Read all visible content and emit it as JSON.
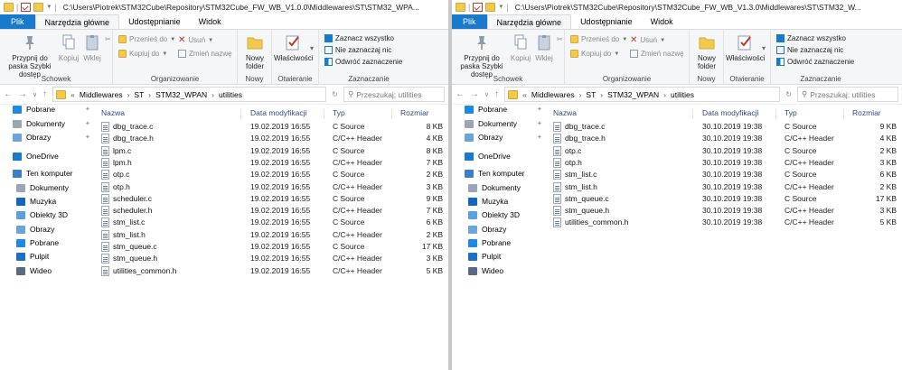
{
  "windows": [
    {
      "title_path": "C:\\Users\\Piotrek\\STM32Cube\\Repository\\STM32Cube_FW_WB_V1.0.0\\Middlewares\\ST\\STM32_WPA...",
      "tabs": [
        "Plik",
        "Narzędzia główne",
        "Udostępnianie",
        "Widok"
      ],
      "ribbon": {
        "pin_label": "Przypnij do paska Szybki dostęp",
        "copy": "Kopiuj",
        "paste": "Wklej",
        "group_clipboard": "Schowek",
        "move_to": "Przenieś do",
        "copy_to": "Kopiuj do",
        "delete": "Usuń",
        "rename": "Zmień nazwę",
        "group_organize": "Organizowanie",
        "new_folder": "Nowy folder",
        "group_new": "Nowy",
        "properties": "Właściwości",
        "group_open": "Otwieranie",
        "select_all": "Zaznacz wszystko",
        "select_none": "Nie zaznaczaj nic",
        "invert": "Odwróć zaznaczenie",
        "group_select": "Zaznaczanie"
      },
      "breadcrumb": [
        "«",
        "Middlewares",
        "ST",
        "STM32_WPAN",
        "utilities"
      ],
      "search_placeholder": "Przeszukaj: utilities",
      "nav": [
        {
          "label": "Pobrane",
          "icon": "download-icon",
          "pinned": true
        },
        {
          "label": "Dokumenty",
          "icon": "documents-icon",
          "pinned": true
        },
        {
          "label": "Obrazy",
          "icon": "pictures-icon",
          "pinned": true
        },
        {
          "label": "OneDrive",
          "icon": "onedrive-icon",
          "pinned": false
        },
        {
          "label": "Ten komputer",
          "icon": "computer-icon",
          "pinned": false
        },
        {
          "label": "Dokumenty",
          "icon": "documents-icon",
          "pinned": false
        },
        {
          "label": "Muzyka",
          "icon": "music-icon",
          "pinned": false
        },
        {
          "label": "Obiekty 3D",
          "icon": "objects3d-icon",
          "pinned": false
        },
        {
          "label": "Obrazy",
          "icon": "pictures-icon",
          "pinned": false
        },
        {
          "label": "Pobrane",
          "icon": "download-icon",
          "pinned": false
        },
        {
          "label": "Pulpit",
          "icon": "desktop-icon",
          "pinned": false
        },
        {
          "label": "Wideo",
          "icon": "video-icon",
          "pinned": false
        }
      ],
      "columns": [
        "Nazwa",
        "Data modyfikacji",
        "Typ",
        "Rozmiar"
      ],
      "files": [
        {
          "name": "dbg_trace.c",
          "date": "19.02.2019 16:55",
          "type": "C Source",
          "size": "8 KB"
        },
        {
          "name": "dbg_trace.h",
          "date": "19.02.2019 16:55",
          "type": "C/C++ Header",
          "size": "4 KB"
        },
        {
          "name": "lpm.c",
          "date": "19.02.2019 16:55",
          "type": "C Source",
          "size": "8 KB"
        },
        {
          "name": "lpm.h",
          "date": "19.02.2019 16:55",
          "type": "C/C++ Header",
          "size": "7 KB"
        },
        {
          "name": "otp.c",
          "date": "19.02.2019 16:55",
          "type": "C Source",
          "size": "2 KB"
        },
        {
          "name": "otp.h",
          "date": "19.02.2019 16:55",
          "type": "C/C++ Header",
          "size": "3 KB"
        },
        {
          "name": "scheduler.c",
          "date": "19.02.2019 16:55",
          "type": "C Source",
          "size": "9 KB"
        },
        {
          "name": "scheduler.h",
          "date": "19.02.2019 16:55",
          "type": "C/C++ Header",
          "size": "7 KB"
        },
        {
          "name": "stm_list.c",
          "date": "19.02.2019 16:55",
          "type": "C Source",
          "size": "6 KB"
        },
        {
          "name": "stm_list.h",
          "date": "19.02.2019 16:55",
          "type": "C/C++ Header",
          "size": "2 KB"
        },
        {
          "name": "stm_queue.c",
          "date": "19.02.2019 16:55",
          "type": "C Source",
          "size": "17 KB"
        },
        {
          "name": "stm_queue.h",
          "date": "19.02.2019 16:55",
          "type": "C/C++ Header",
          "size": "3 KB"
        },
        {
          "name": "utilities_common.h",
          "date": "19.02.2019 16:55",
          "type": "C/C++ Header",
          "size": "5 KB"
        }
      ]
    },
    {
      "title_path": "C:\\Users\\Piotrek\\STM32Cube\\Repository\\STM32Cube_FW_WB_V1.3.0\\Middlewares\\ST\\STM32_W...",
      "tabs": [
        "Plik",
        "Narzędzia główne",
        "Udostępnianie",
        "Widok"
      ],
      "ribbon": {
        "pin_label": "Przypnij do paska Szybki dostęp",
        "copy": "Kopiuj",
        "paste": "Wklej",
        "group_clipboard": "Schowek",
        "move_to": "Przenieś do",
        "copy_to": "Kopiuj do",
        "delete": "Usuń",
        "rename": "Zmień nazwę",
        "group_organize": "Organizowanie",
        "new_folder": "Nowy folder",
        "group_new": "Nowy",
        "properties": "Właściwości",
        "group_open": "Otwieranie",
        "select_all": "Zaznacz wszystko",
        "select_none": "Nie zaznaczaj nic",
        "invert": "Odwróć zaznaczenie",
        "group_select": "Zaznaczanie"
      },
      "breadcrumb": [
        "«",
        "Middlewares",
        "ST",
        "STM32_WPAN",
        "utilities"
      ],
      "search_placeholder": "Przeszukaj: utilities",
      "nav": [
        {
          "label": "Pobrane",
          "icon": "download-icon",
          "pinned": true
        },
        {
          "label": "Dokumenty",
          "icon": "documents-icon",
          "pinned": true
        },
        {
          "label": "Obrazy",
          "icon": "pictures-icon",
          "pinned": true
        },
        {
          "label": "OneDrive",
          "icon": "onedrive-icon",
          "pinned": false
        },
        {
          "label": "Ten komputer",
          "icon": "computer-icon",
          "pinned": false
        },
        {
          "label": "Dokumenty",
          "icon": "documents-icon",
          "pinned": false
        },
        {
          "label": "Muzyka",
          "icon": "music-icon",
          "pinned": false
        },
        {
          "label": "Obiekty 3D",
          "icon": "objects3d-icon",
          "pinned": false
        },
        {
          "label": "Obrazy",
          "icon": "pictures-icon",
          "pinned": false
        },
        {
          "label": "Pobrane",
          "icon": "download-icon",
          "pinned": false
        },
        {
          "label": "Pulpit",
          "icon": "desktop-icon",
          "pinned": false
        },
        {
          "label": "Wideo",
          "icon": "video-icon",
          "pinned": false
        }
      ],
      "columns": [
        "Nazwa",
        "Data modyfikacji",
        "Typ",
        "Rozmiar"
      ],
      "files": [
        {
          "name": "dbg_trace.c",
          "date": "30.10.2019 19:38",
          "type": "C Source",
          "size": "9 KB"
        },
        {
          "name": "dbg_trace.h",
          "date": "30.10.2019 19:38",
          "type": "C/C++ Header",
          "size": "4 KB"
        },
        {
          "name": "otp.c",
          "date": "30.10.2019 19:38",
          "type": "C Source",
          "size": "2 KB"
        },
        {
          "name": "otp.h",
          "date": "30.10.2019 19:38",
          "type": "C/C++ Header",
          "size": "3 KB"
        },
        {
          "name": "stm_list.c",
          "date": "30.10.2019 19:38",
          "type": "C Source",
          "size": "6 KB"
        },
        {
          "name": "stm_list.h",
          "date": "30.10.2019 19:38",
          "type": "C/C++ Header",
          "size": "2 KB"
        },
        {
          "name": "stm_queue.c",
          "date": "30.10.2019 19:38",
          "type": "C Source",
          "size": "17 KB"
        },
        {
          "name": "stm_queue.h",
          "date": "30.10.2019 19:38",
          "type": "C/C++ Header",
          "size": "3 KB"
        },
        {
          "name": "utilities_common.h",
          "date": "30.10.2019 19:38",
          "type": "C/C++ Header",
          "size": "5 KB"
        }
      ]
    }
  ],
  "colors": {
    "accent": "#1979ca",
    "folder": "#f2c94c",
    "header_text": "#2c4f7c"
  }
}
